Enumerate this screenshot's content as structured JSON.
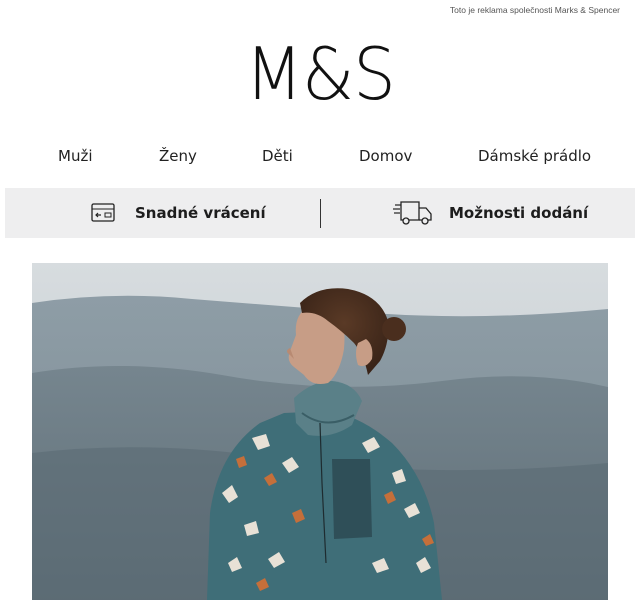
{
  "ad_notice": "Toto je reklama společnosti Marks & Spencer",
  "logo": "M&S",
  "nav": {
    "items": [
      "Muži",
      "Ženy",
      "Děti",
      "Domov",
      "Dámské prádlo"
    ]
  },
  "services": {
    "returns_label": "Snadné vrácení",
    "returns_icon": "card-return-icon",
    "delivery_label": "Možnosti dodání",
    "delivery_icon": "delivery-truck-icon",
    "background": "#eeeeef"
  },
  "hero": {
    "image": "woman-in-patterned-fleece-on-misty-hills"
  }
}
